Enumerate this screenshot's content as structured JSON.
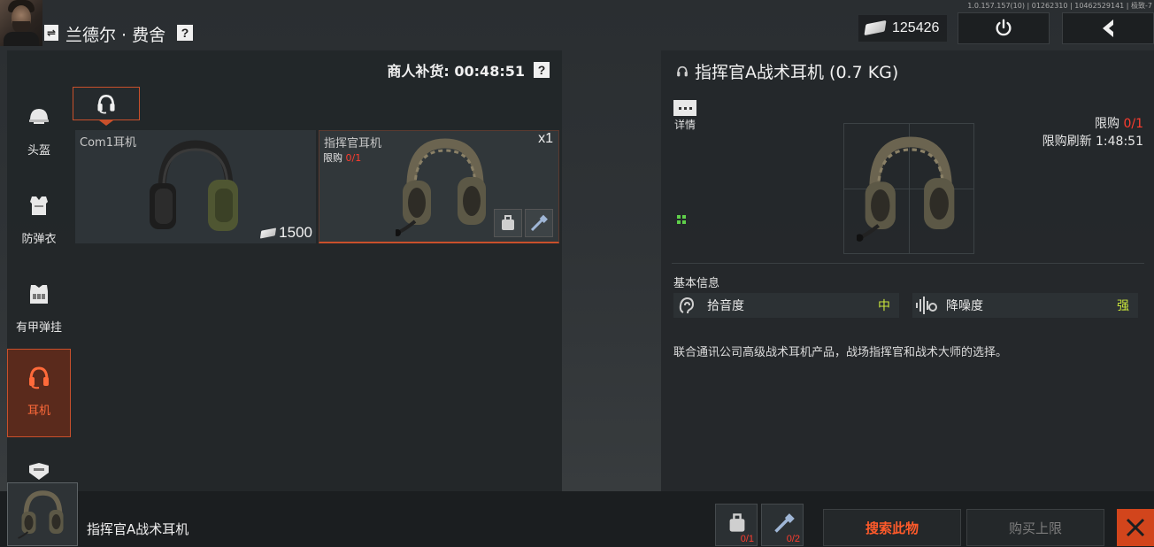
{
  "version": "1.0.157.157(10) | 01262310 | 10462529141 | 极致-7",
  "player": {
    "name": "兰德尔 · 费舍",
    "help_label": "?"
  },
  "currency": {
    "amount": "125426"
  },
  "merchant": {
    "restock_label": "商人补货: 00:48:51",
    "help_label": "?"
  },
  "categories": [
    {
      "label": "头盔",
      "icon": "helmet-icon",
      "active": false
    },
    {
      "label": "防弹衣",
      "icon": "body-armor-icon",
      "active": false
    },
    {
      "label": "有甲弹挂",
      "icon": "armored-rig-icon",
      "active": false
    },
    {
      "label": "耳机",
      "icon": "headset-icon",
      "active": true
    },
    {
      "label": "",
      "icon": "mask-icon",
      "active": false
    }
  ],
  "items": [
    {
      "name": "Com1耳机",
      "price": "1500"
    },
    {
      "name": "指挥官耳机",
      "limit_label": "限购",
      "limit_value": "0/1",
      "qty": "x1"
    }
  ],
  "detail": {
    "title": "指挥官A战术耳机 (0.7 KG)",
    "detail_label": "详情",
    "limit_label": "限购",
    "limit_value": "0/1",
    "refresh_label": "限购刷新 1:48:51",
    "basic_info_label": "基本信息",
    "stats": [
      {
        "name": "拾音度",
        "value": "中",
        "icon": "ear-icon"
      },
      {
        "name": "降噪度",
        "value": "强",
        "icon": "sound-wave-icon"
      }
    ],
    "description": "联合通讯公司高级战术耳机产品，战场指挥官和战术大师的选择。",
    "accent_color": "#c9502b",
    "stat_value_color": "#c9e53b"
  },
  "bottom": {
    "item_name": "指挥官A战术耳机",
    "slot1_count": "0/1",
    "slot2_count": "0/2",
    "search_label": "搜索此物",
    "buy_limit_label": "购买上限"
  }
}
